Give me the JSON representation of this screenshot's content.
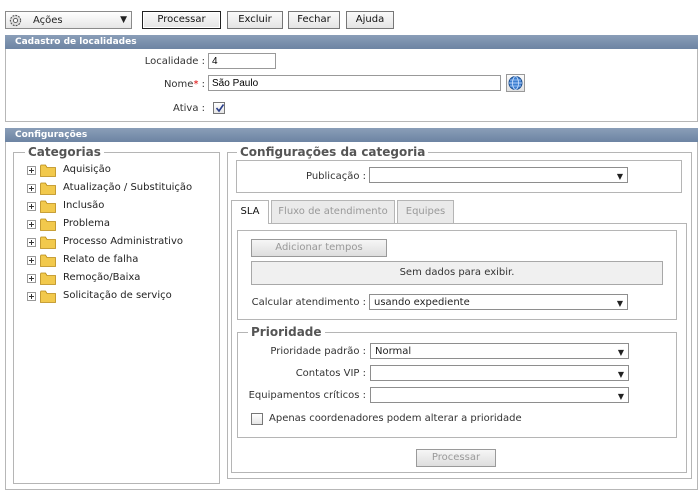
{
  "toolbar": {
    "actions_label": "Ações",
    "buttons": {
      "process": "Processar",
      "delete": "Excluir",
      "close": "Fechar",
      "help": "Ajuda"
    }
  },
  "cadastro": {
    "header": "Cadastro de localidades",
    "localidade_label": "Localidade :",
    "localidade_value": "4",
    "nome_label": "Nome",
    "nome_required": "*",
    "nome_colon": " :",
    "nome_value": "São Paulo",
    "ativa_label": "Ativa :",
    "ativa_checked": true
  },
  "configuracoes": {
    "header": "Configurações",
    "categorias_title": "Categorias",
    "categories": [
      "Aquisição",
      "Atualização / Substituição",
      "Inclusão",
      "Problema",
      "Processo Administrativo",
      "Relato de falha",
      "Remoção/Baixa",
      "Solicitação de serviço"
    ],
    "config_categoria_title": "Configurações da categoria",
    "publicacao_label": "Publicação :",
    "publicacao_value": "",
    "tabs": [
      "SLA",
      "Fluxo de atendimento",
      "Equipes"
    ],
    "add_times_button": "Adicionar tempos",
    "no_data": "Sem dados para exibir.",
    "calcular_label": "Calcular atendimento :",
    "calcular_value": "usando expediente",
    "prioridade_title": "Prioridade",
    "prioridade_padrao_label": "Prioridade padrão :",
    "prioridade_padrao_value": "Normal",
    "contatos_vip_label": "Contatos VIP :",
    "contatos_vip_value": "",
    "equipamentos_label": "Equipamentos críticos :",
    "equipamentos_value": "",
    "apenas_label": "Apenas coordenadores podem alterar a prioridade",
    "processar_button": "Processar"
  },
  "colors": {
    "header_bar": "#7a8fab",
    "folder": "#f2c94c"
  }
}
